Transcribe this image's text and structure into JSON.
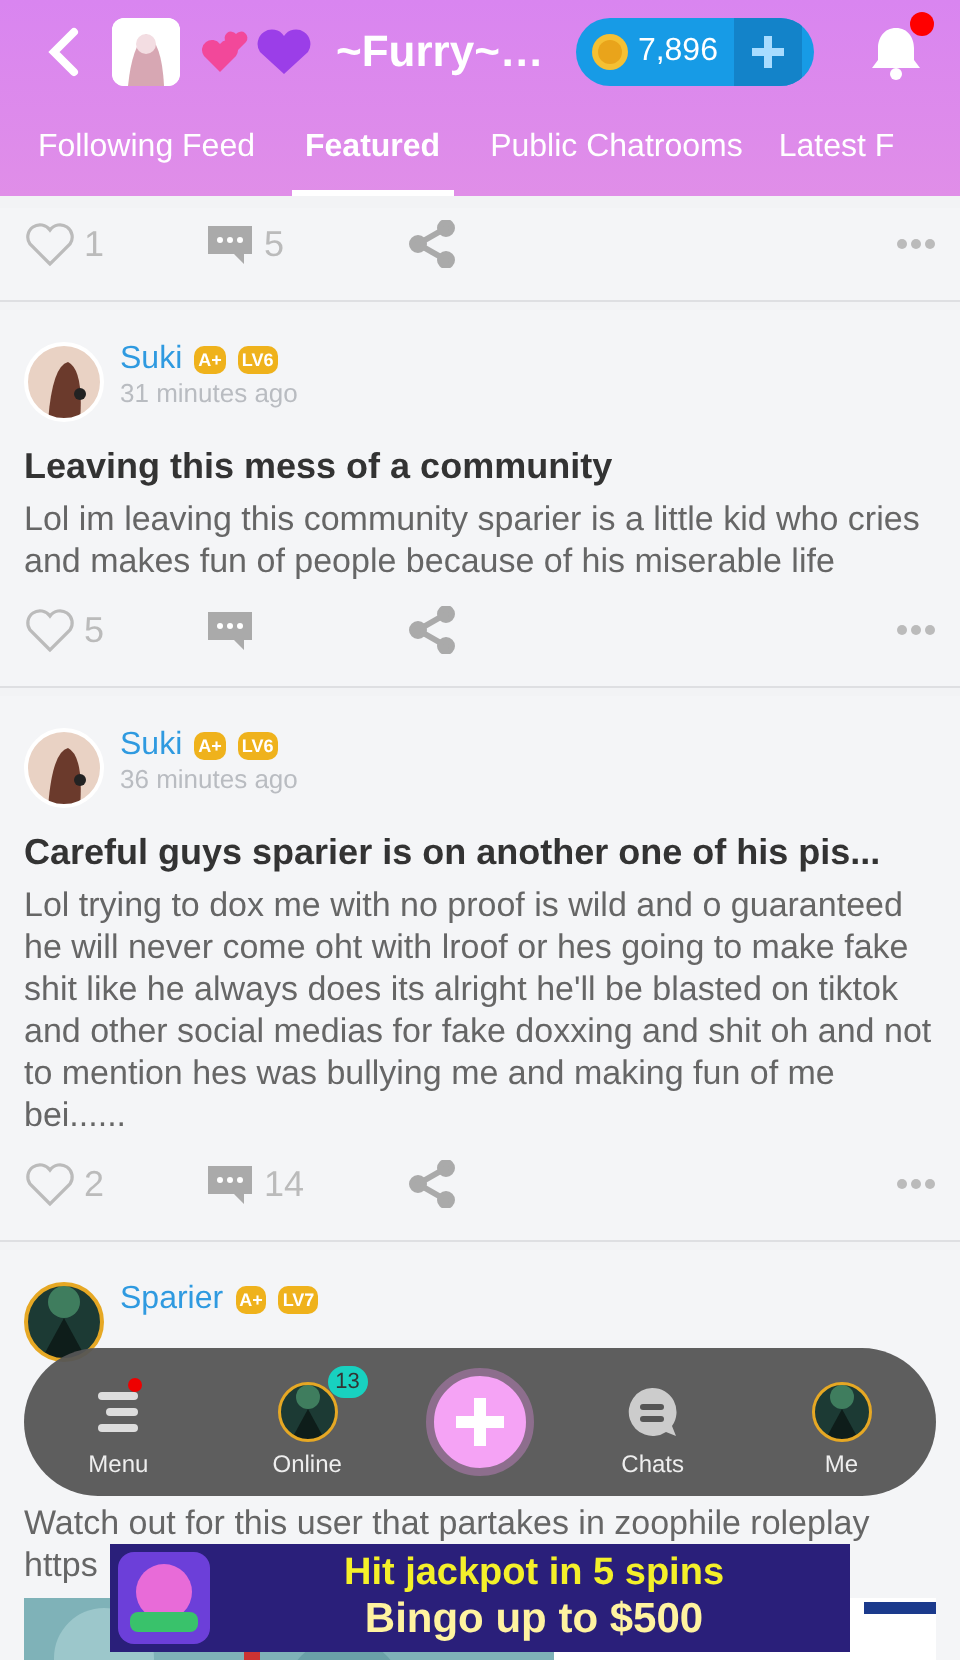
{
  "header": {
    "title": "~Furry~…",
    "coins": "7,896",
    "notification_dot": true
  },
  "tabs": [
    {
      "label": "Following Feed",
      "selected": false
    },
    {
      "label": "Featured",
      "selected": true
    },
    {
      "label": "Public Chatrooms",
      "selected": false
    },
    {
      "label": "Latest F",
      "selected": false
    }
  ],
  "posts": [
    {
      "likes": "1",
      "comments": "5"
    },
    {
      "author": "Suki",
      "badges": [
        "A+",
        "LV6"
      ],
      "time": "31 minutes ago",
      "title": "Leaving this mess of a community",
      "body": "Lol im leaving this community sparier is a little kid who cries and makes fun of people because of his miserable life",
      "likes": "5"
    },
    {
      "author": "Suki",
      "badges": [
        "A+",
        "LV6"
      ],
      "time": "36 minutes ago",
      "title": "Careful guys sparier is on another one of his pis...",
      "body": "Lol trying to dox me with no proof is wild and o guaranteed he will never come oht with lroof or hes going to make fake shit like he always does its alright he'll be blasted on tiktok and other social medias for fake doxxing and shit oh and not to mention hes was bullying me and making fun of me bei......",
      "likes": "2",
      "comments": "14"
    },
    {
      "author": "Sparier",
      "badges": [
        "A+",
        "LV7"
      ],
      "body_lines": [
        "Watch out for this user that partakes in zoophile roleplay",
        "https"
      ],
      "picture": true
    }
  ],
  "nav": [
    {
      "kind": "menu",
      "label": "Menu",
      "dot": true
    },
    {
      "kind": "online",
      "label": "Online",
      "count": "13"
    },
    {
      "kind": "create"
    },
    {
      "kind": "chats",
      "label": "Chats"
    },
    {
      "kind": "me",
      "label": "Me"
    }
  ],
  "ad": {
    "lines": [
      "Hit jackpot in 5 spins",
      "Bingo up to $500"
    ]
  }
}
